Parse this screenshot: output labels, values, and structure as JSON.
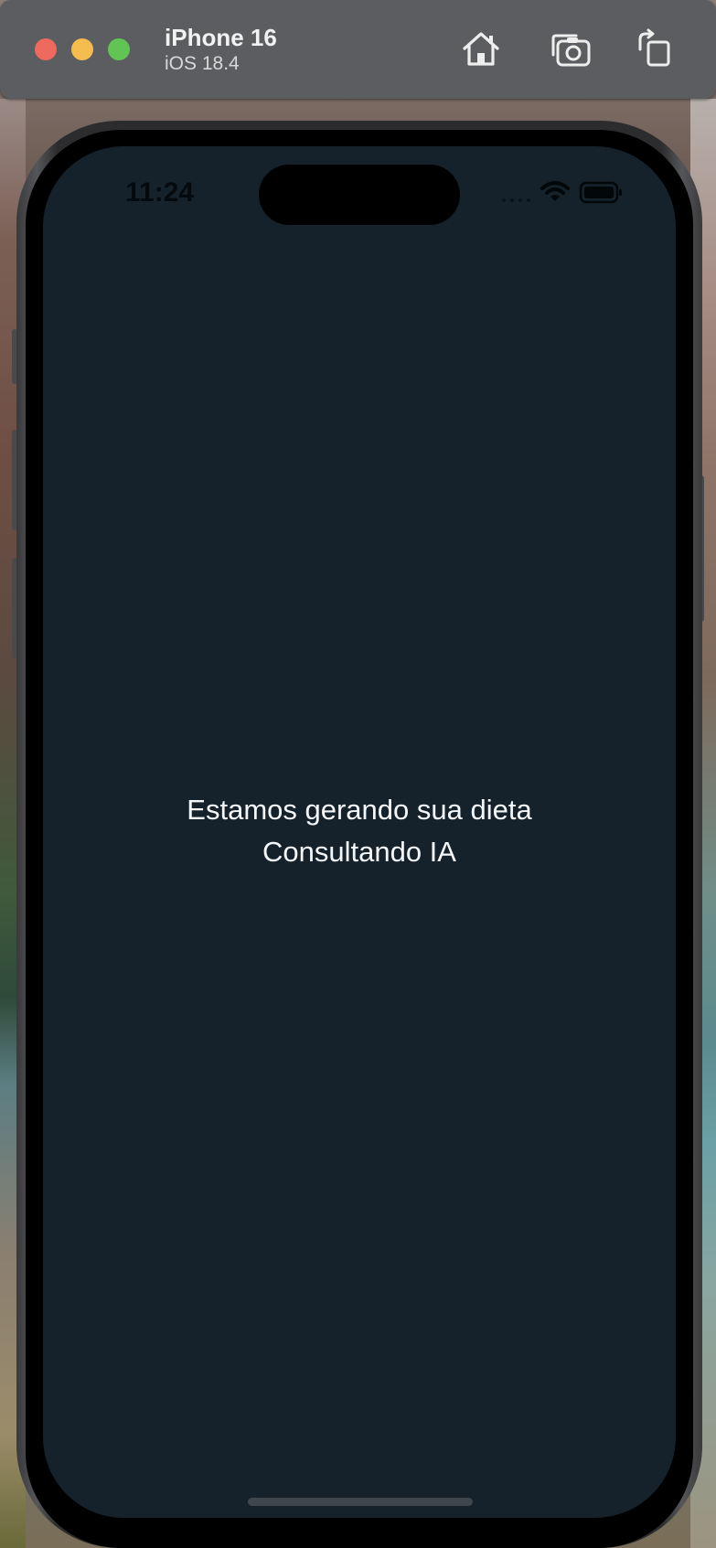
{
  "simulator": {
    "device_name": "iPhone 16",
    "os_version": "iOS 18.4",
    "toolbar": {
      "home_icon": "home-icon",
      "screenshot_icon": "screenshot-icon",
      "rotate_icon": "rotate-icon"
    }
  },
  "status_bar": {
    "time": "11:24",
    "wifi_icon": "wifi-icon",
    "battery_icon": "battery-icon"
  },
  "screen": {
    "background": "#15222b",
    "message_line1": "Estamos gerando sua dieta",
    "message_line2": "Consultando IA"
  },
  "colors": {
    "close": "#ee6a5f",
    "minimize": "#f5bd4f",
    "maximize": "#61c454",
    "titlebar": "#5b5d60"
  }
}
